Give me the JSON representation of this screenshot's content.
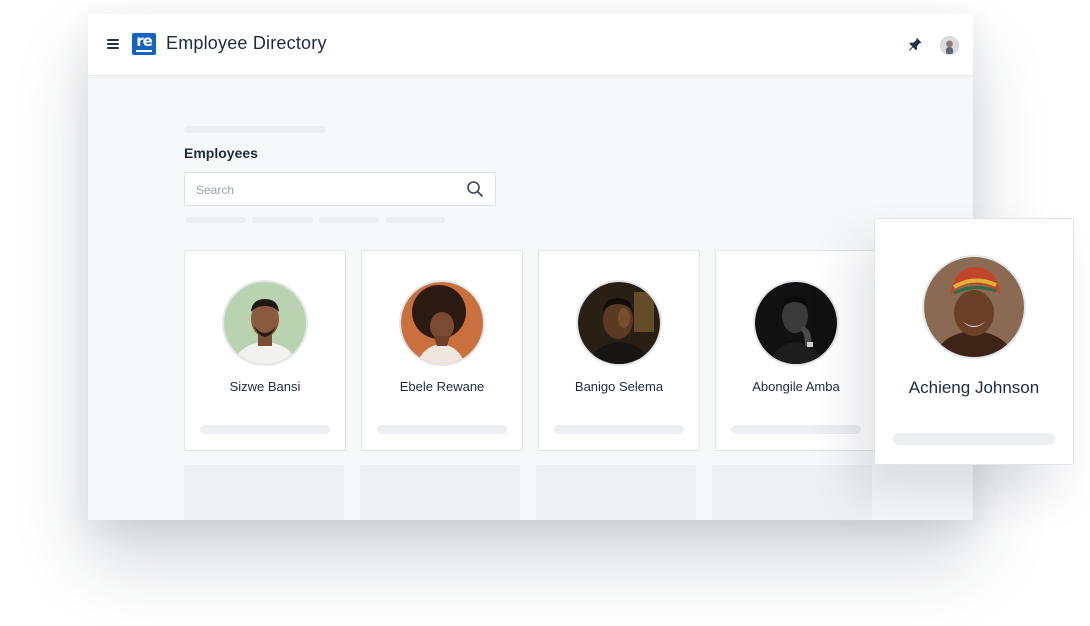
{
  "header": {
    "menu_icon": "hamburger-icon",
    "logo_text": "re",
    "title": "Employee Directory",
    "pin_icon": "pin-icon",
    "user_avatar": "user-avatar"
  },
  "main": {
    "section_title": "Employees",
    "search": {
      "placeholder": "Search",
      "value": "",
      "icon": "search-icon"
    },
    "employees": [
      {
        "name": "Sizwe Bansi"
      },
      {
        "name": "Ebele Rewane"
      },
      {
        "name": "Banigo Selema"
      },
      {
        "name": "Abongile Amba"
      }
    ],
    "highlighted_employee": {
      "name": "Achieng Johnson"
    }
  },
  "colors": {
    "brand": "#1565c0",
    "text": "#1d2b40",
    "background": "#f7f8fa",
    "skeleton": "#eceef2"
  }
}
